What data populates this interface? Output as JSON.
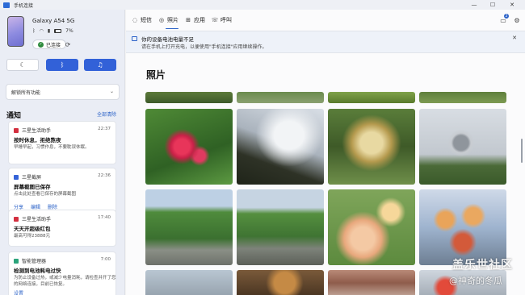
{
  "window": {
    "title": "手机连接",
    "minimize": "—",
    "maximize": "☐",
    "close": "✕"
  },
  "device": {
    "name": "Galaxy A54 5G",
    "battery": "7%",
    "status": "已连接"
  },
  "quick_buttons": [
    {
      "icon": "moon-icon",
      "glyph": "☾"
    },
    {
      "icon": "bluetooth-icon",
      "glyph": "ᛒ"
    },
    {
      "icon": "music-icon",
      "glyph": "♫"
    }
  ],
  "unlock_label": "解锁所有功能",
  "notifications": {
    "header": "通知",
    "clear_all": "全部清除",
    "items": [
      {
        "app": "三星生活助手",
        "app_color": "#d32f3f",
        "time": "22:37",
        "title": "按时休息，拒绝熬夜",
        "body": "早睡早起，习惯作息，不要耽误休眠。",
        "body2": "",
        "actions": []
      },
      {
        "app": "三星截屏",
        "app_color": "#3563d8",
        "time": "22:36",
        "title": "屏幕截图已保存",
        "body": "点击此处查看已保存的屏幕截图",
        "body2": "",
        "actions": [
          "分享",
          "编辑",
          "删除"
        ]
      },
      {
        "app": "三星生活助手",
        "app_color": "#d32f3f",
        "time": "17:40",
        "title": "天天开超级红包",
        "body": "最高可得23888元",
        "body2": "",
        "actions": []
      },
      {
        "app": "智能管理器",
        "app_color": "#2aa37a",
        "time": "7:00",
        "title": "检测到电池耗电过快",
        "body": "为防止设备过热，或减少电量消耗，请检查并开了您",
        "body2": "的网络连接，目前已恢复。",
        "actions": [
          "设置"
        ]
      }
    ]
  },
  "tabs": [
    {
      "label": "短信",
      "icon": "chat-icon",
      "glyph": "◌"
    },
    {
      "label": "照片",
      "icon": "photo-icon",
      "glyph": "◎"
    },
    {
      "label": "应用",
      "icon": "apps-icon",
      "glyph": "⊞"
    },
    {
      "label": "呼叫",
      "icon": "phone-icon",
      "glyph": "☏"
    }
  ],
  "notif_count": "2",
  "banner": {
    "title": "你的设备电池电量不足",
    "message": "请在手机上打开充电，以便使用\"手机连接\"应用继续操作。"
  },
  "photos_title": "照片",
  "watermark": {
    "line1": "盖乐世社区",
    "line2": "@神奇的冬瓜"
  },
  "colors": {
    "accent": "#2d63c8",
    "quick_button_blue": "#3261d8"
  }
}
